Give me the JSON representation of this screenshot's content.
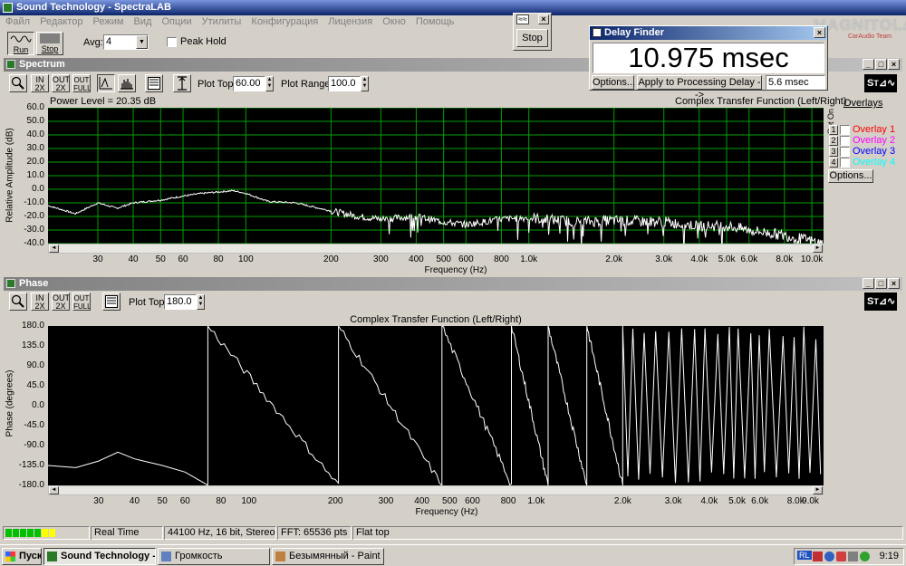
{
  "app": {
    "title": "Sound Technology - SpectraLAB"
  },
  "menu": [
    "Файл",
    "Редактор",
    "Режим",
    "Вид",
    "Опции",
    "Утилиты",
    "Конфигурация",
    "Лицензия",
    "Окно",
    "Помощь"
  ],
  "toolbar": {
    "run_label": "Run",
    "stop_label": "Stop",
    "avg_label": "Avg:",
    "avg_value": "4",
    "peak_hold_label": "Peak Hold"
  },
  "stop_window": {
    "title": "≈≈",
    "stop_label": "Stop"
  },
  "delay_finder": {
    "title": "Delay Finder",
    "readout": "10.975 msec",
    "options_label": "Options...",
    "apply_label": "Apply to Processing Delay -->",
    "delay_value": "5.6 msec"
  },
  "watermark": {
    "main": "MAGNITOLA",
    "sub": "CarAudio Team"
  },
  "spectrum": {
    "title": "Spectrum",
    "plot_top_label": "Plot Top:",
    "plot_top_value": "60.00",
    "plot_range_label": "Plot Range:",
    "plot_range_value": "100.0",
    "power_level": "Power Level = 20.35 dB",
    "chart_title": "Complex Transfer Function (Left/Right)",
    "ylabel": "Relative Amplitude (dB)",
    "xlabel": "Frequency (Hz)",
    "button_labels": {
      "zoom_in_1": "IN\n2X",
      "zoom_out_1": "OUT\n2X",
      "zoom_out_2": "OUT\nFULL"
    },
    "overlays_label": "Overlays",
    "set_on_label": "Set On",
    "overlays": [
      {
        "num": "1",
        "name": "Overlay 1",
        "color": "#ff0000"
      },
      {
        "num": "2",
        "name": "Overlay 2",
        "color": "#ff00ff"
      },
      {
        "num": "3",
        "name": "Overlay 3",
        "color": "#0000ff"
      },
      {
        "num": "4",
        "name": "Overlay 4",
        "color": "#00ffff"
      }
    ],
    "overlay_options_label": "Options..."
  },
  "phase": {
    "title": "Phase",
    "plot_top_label": "Plot Top:",
    "plot_top_value": "180.0",
    "chart_title": "Complex Transfer Function (Left/Right)",
    "ylabel": "Phase (degrees)",
    "xlabel": "Frequency (Hz)"
  },
  "chart_data": [
    {
      "type": "line",
      "title": "Complex Transfer Function (Left/Right)",
      "xlabel": "Frequency (Hz)",
      "ylabel": "Relative Amplitude (dB)",
      "x_scale": "log",
      "xlim": [
        20,
        11000
      ],
      "ylim": [
        -40,
        60
      ],
      "yticks": [
        "60.0",
        "50.0",
        "40.0",
        "30.0",
        "20.0",
        "10.0",
        "0.0",
        "-10.0",
        "-20.0",
        "-30.0",
        "-40.0"
      ],
      "xticks": [
        {
          "v": 30,
          "t": "30"
        },
        {
          "v": 40,
          "t": "40"
        },
        {
          "v": 50,
          "t": "50"
        },
        {
          "v": 60,
          "t": "60"
        },
        {
          "v": 80,
          "t": "80"
        },
        {
          "v": 100,
          "t": "100"
        },
        {
          "v": 200,
          "t": "200"
        },
        {
          "v": 300,
          "t": "300"
        },
        {
          "v": 400,
          "t": "400"
        },
        {
          "v": 500,
          "t": "500"
        },
        {
          "v": 600,
          "t": "600"
        },
        {
          "v": 800,
          "t": "800"
        },
        {
          "v": 1000,
          "t": "1.0k"
        },
        {
          "v": 2000,
          "t": "2.0k"
        },
        {
          "v": 3000,
          "t": "3.0k"
        },
        {
          "v": 4000,
          "t": "4.0k"
        },
        {
          "v": 5000,
          "t": "5.0k"
        },
        {
          "v": 6000,
          "t": "6.0k"
        },
        {
          "v": 8000,
          "t": "8.0k"
        },
        {
          "v": 10000,
          "t": "10.0k"
        }
      ],
      "grid": true,
      "background": "#000000",
      "grid_color": "#00a000",
      "line_color": "#ffffff",
      "series": [
        {
          "x": [
            20,
            25,
            30,
            35,
            40,
            50,
            60,
            70,
            80,
            90,
            100,
            120,
            150,
            200,
            250,
            300,
            400,
            500,
            600,
            800,
            1000,
            1500,
            2000,
            3000,
            4000,
            5000,
            6000,
            8000,
            10000,
            11000
          ],
          "y": [
            -12,
            -18,
            -10,
            -14,
            -10,
            -8,
            -5,
            -3,
            -2,
            -1,
            -3,
            -9,
            -10,
            -16,
            -20,
            -22,
            -20,
            -24,
            -26,
            -22,
            -21,
            -24,
            -23,
            -24,
            -27,
            -27,
            -30,
            -34,
            -38,
            -40
          ]
        }
      ]
    },
    {
      "type": "line",
      "title": "Complex Transfer Function (Left/Right)",
      "xlabel": "Frequency (Hz)",
      "ylabel": "Phase (degrees)",
      "x_scale": "log",
      "xlim": [
        20,
        10000
      ],
      "ylim": [
        -180,
        180
      ],
      "yticks": [
        "180.0",
        "135.0",
        "90.0",
        "45.0",
        "0.0",
        "-45.0",
        "-90.0",
        "-135.0",
        "-180.0"
      ],
      "xticks": [
        {
          "v": 30,
          "t": "30"
        },
        {
          "v": 40,
          "t": "40"
        },
        {
          "v": 50,
          "t": "50"
        },
        {
          "v": 60,
          "t": "60"
        },
        {
          "v": 80,
          "t": "80"
        },
        {
          "v": 100,
          "t": "100"
        },
        {
          "v": 200,
          "t": "200"
        },
        {
          "v": 300,
          "t": "300"
        },
        {
          "v": 400,
          "t": "400"
        },
        {
          "v": 500,
          "t": "500"
        },
        {
          "v": 600,
          "t": "600"
        },
        {
          "v": 800,
          "t": "800"
        },
        {
          "v": 1000,
          "t": "1.0k"
        },
        {
          "v": 2000,
          "t": "2.0k"
        },
        {
          "v": 3000,
          "t": "3.0k"
        },
        {
          "v": 4000,
          "t": "4.0k"
        },
        {
          "v": 5000,
          "t": "5.0k"
        },
        {
          "v": 6000,
          "t": "6.0k"
        },
        {
          "v": 8000,
          "t": "8.0k"
        },
        {
          "v": 9000,
          "t": "9.0k"
        }
      ],
      "grid": false,
      "background": "#000000",
      "line_color": "#ffffff",
      "wraps_hz": [
        72,
        205,
        470,
        820,
        1100,
        1500,
        2000
      ],
      "series": [
        {
          "x": [
            20,
            25,
            30,
            35,
            40,
            50,
            60,
            70,
            72
          ],
          "y": [
            -135,
            -140,
            -125,
            -105,
            -120,
            -135,
            -150,
            -175,
            -180
          ]
        }
      ]
    }
  ],
  "status": {
    "mode": "Real Time",
    "format": "44100 Hz, 16 bit, Stereo",
    "fft": "FFT: 65536 pts",
    "window": "Flat top"
  },
  "taskbar": {
    "start_label": "Пуск",
    "tasks": [
      "Sound Technology - S...",
      "Громкость",
      "Безымянный - Paint"
    ],
    "lang": "RL",
    "clock": "9:19"
  }
}
